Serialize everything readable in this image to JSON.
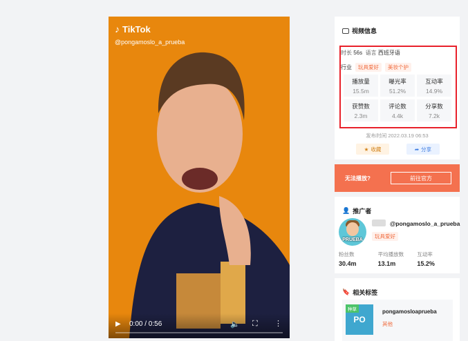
{
  "video": {
    "brand": "TikTok",
    "handle": "@pongamoslo_a_prueba",
    "time": "0:00 / 0:56",
    "progress": 0.0
  },
  "video_info": {
    "title": "视频信息",
    "duration_label": "时长",
    "duration": "56s",
    "language_label": "语言",
    "language": "西班牙语",
    "industry_label": "行业",
    "industry_tags": [
      "玩具爱好",
      "美妆个护"
    ],
    "stats": [
      {
        "label": "播放量",
        "value": "15.5m"
      },
      {
        "label": "曝光率",
        "value": "51.2%"
      },
      {
        "label": "互动率",
        "value": "14.9%"
      },
      {
        "label": "获赞数",
        "value": "2.3m"
      },
      {
        "label": "评论数",
        "value": "4.4k"
      },
      {
        "label": "分享数",
        "value": "7.2k"
      }
    ],
    "publish_time": "发布时间 2022.03.19 06:53",
    "favorite_label": "收藏",
    "share_label": "分享"
  },
  "cta": {
    "label": "无法播放?",
    "button": "前往官方"
  },
  "promoter": {
    "title": "推广者",
    "avatar_text": "PRUEBA",
    "name": "@pongamoslo_a_prueba",
    "tag": "玩具爱好",
    "stats": [
      {
        "label": "粉丝数",
        "value": "30.4m"
      },
      {
        "label": "平均播放数",
        "value": "13.1m"
      },
      {
        "label": "互动率",
        "value": "15.2%"
      }
    ]
  },
  "related_tags": {
    "title": "相关标签",
    "card": {
      "badge": "种草",
      "thumb": "PO",
      "name": "pongamosloaprueba",
      "sub": "其他"
    }
  },
  "colors": {
    "accent": "#f4714f",
    "highlight_border": "#e8202a",
    "video_bg": "#e8870d"
  }
}
